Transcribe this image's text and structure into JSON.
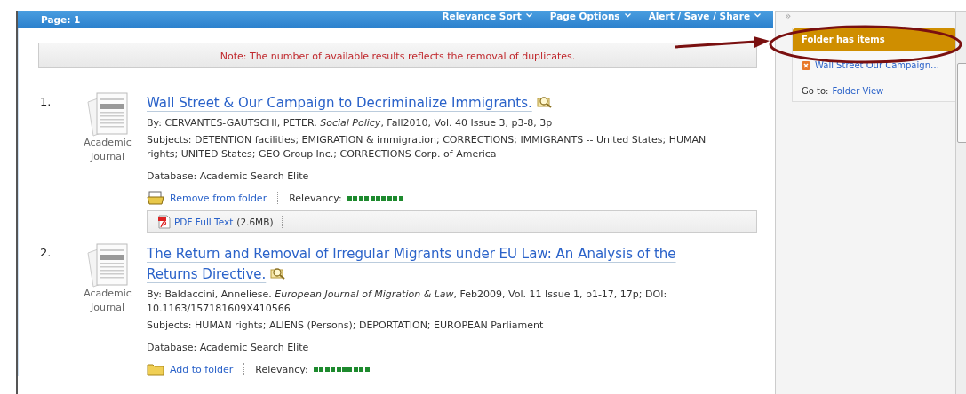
{
  "header": {
    "page_label": "Page: 1",
    "menus": [
      {
        "label": "Relevance Sort"
      },
      {
        "label": "Page Options"
      },
      {
        "label": "Alert / Save / Share"
      }
    ]
  },
  "note": "Note: The number of available results reflects the removal of duplicates.",
  "results": [
    {
      "number": "1.",
      "type_label": [
        "Academic",
        "Journal"
      ],
      "title": "Wall Street & Our Campaign to Decriminalize Immigrants.",
      "byline": "By: CERVANTES-GAUTSCHI, PETER. *Social Policy*, Fall2010, Vol. 40 Issue 3, p3-8, 3p",
      "subjects": "Subjects: DETENTION facilities; EMIGRATION & immigration; CORRECTIONS; IMMIGRANTS -- United States; HUMAN rights; UNITED States; GEO Group Inc.; CORRECTIONS Corp. of America",
      "database": "Database: Academic Search Elite",
      "in_folder": true,
      "folder_action": "Remove from folder",
      "relevancy_label": "Relevancy:",
      "level": 1,
      "full_text": {
        "label": "PDF Full Text",
        "size": "(2.6MB)"
      }
    },
    {
      "number": "2.",
      "type_label": [
        "Academic",
        "Journal"
      ],
      "title": "The Return and Removal of Irregular Migrants under EU Law: An Analysis of the Returns Directive.",
      "byline": "By: Baldaccini, Anneliese. *European Journal of Migration & Law*, Feb2009, Vol. 11 Issue 1, p1-17, 17p; DOI: 10.1163/157181609X410566",
      "subjects": "Subjects: HUMAN rights; ALIENS (Persons); DEPORTATION; EUROPEAN Parliament",
      "database": "Database: Academic Search Elite",
      "in_folder": false,
      "folder_action": "Add to folder",
      "relevancy_label": "Relevancy:",
      "level": 1
    }
  ],
  "sidebar": {
    "collapse": "»",
    "folder_title": "Folder has items",
    "items": [
      {
        "title": "Wall Street Our Campaign…"
      }
    ],
    "goto_label": "Go to:",
    "goto_link": "Folder View"
  }
}
